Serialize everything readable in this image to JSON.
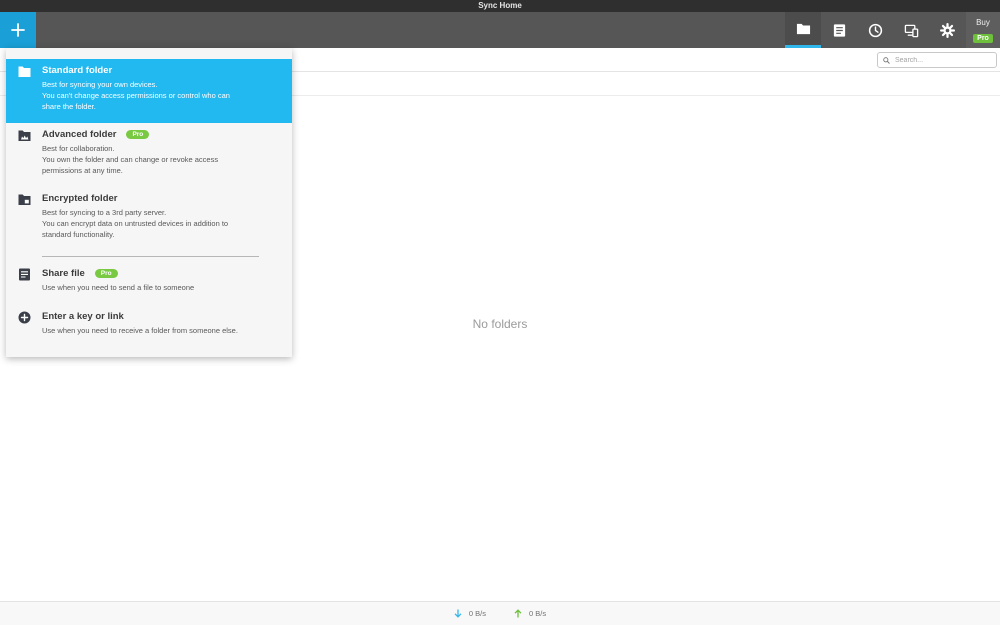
{
  "window": {
    "title": "Sync Home"
  },
  "toolbar": {
    "add_icon": "plus-icon",
    "icons": [
      "folder-icon",
      "document-icon",
      "clock-icon",
      "devices-icon",
      "gear-icon"
    ],
    "active_icon": "folder-icon",
    "buy_label": "Buy",
    "buy_badge": "Pro"
  },
  "search": {
    "placeholder": "Search..."
  },
  "main": {
    "empty_text": "No folders"
  },
  "menu": {
    "items": [
      {
        "title": "Standard folder",
        "badge": "",
        "icon": "folder-icon",
        "selected": true,
        "lines": [
          "Best for syncing your own devices.",
          "You can't change access permissions or control who can",
          "share the folder."
        ]
      },
      {
        "title": "Advanced folder",
        "badge": "Pro",
        "icon": "advanced-folder-icon",
        "selected": false,
        "lines": [
          "Best for collaboration.",
          "You own the folder and can change or revoke access",
          "permissions at any time."
        ]
      },
      {
        "title": "Encrypted folder",
        "badge": "",
        "icon": "encrypted-folder-icon",
        "selected": false,
        "lines": [
          "Best for syncing to a 3rd party server.",
          "You can encrypt data on untrusted devices in addition to",
          "standard functionality."
        ]
      },
      {
        "title": "Share file",
        "badge": "Pro",
        "icon": "share-file-icon",
        "selected": false,
        "lines": [
          "Use when you need to send a file to someone"
        ]
      },
      {
        "title": "Enter a key or link",
        "badge": "",
        "icon": "plus-circle-icon",
        "selected": false,
        "lines": [
          "Use when you need to receive a folder from someone else."
        ]
      }
    ]
  },
  "status": {
    "download": "0 B/s",
    "upload": "0 B/s"
  },
  "colors": {
    "accent": "#22b8f0",
    "add_button": "#1a9fd6",
    "pro_badge": "#7ac943",
    "toolbar": "#565656"
  }
}
